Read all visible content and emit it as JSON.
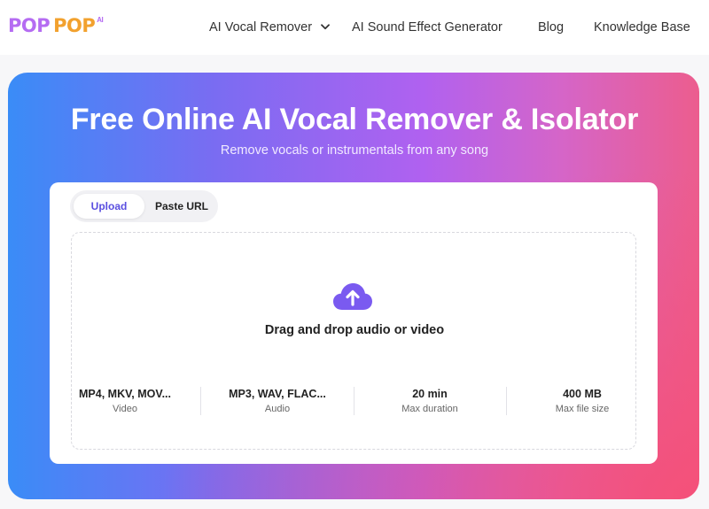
{
  "brand": {
    "word1": "POP",
    "word2": "POP",
    "suffix": "AI"
  },
  "nav": {
    "items": [
      {
        "label": "AI Vocal Remover",
        "has_dropdown": true
      },
      {
        "label": "AI Sound Effect Generator"
      },
      {
        "label": "Blog"
      },
      {
        "label": "Knowledge Base"
      }
    ]
  },
  "hero": {
    "title": "Free Online AI Vocal Remover & Isolator",
    "subtitle": "Remove vocals or instrumentals from any song"
  },
  "upload": {
    "tabs": [
      {
        "label": "Upload",
        "active": true
      },
      {
        "label": "Paste URL"
      }
    ],
    "drop_text": "Drag and drop audio or video",
    "specs": [
      {
        "value": "MP4, MKV, MOV...",
        "label": "Video"
      },
      {
        "value": "MP3, WAV, FLAC...",
        "label": "Audio"
      },
      {
        "value": "20 min",
        "label": "Max duration"
      },
      {
        "value": "400 MB",
        "label": "Max file size"
      }
    ]
  },
  "colors": {
    "accent": "#7a5af0",
    "logo_purple": "#b56cf2",
    "logo_orange": "#f2a12e"
  },
  "icons": {
    "nav_dropdown": "chevron-down-icon",
    "upload": "cloud-upload-icon"
  }
}
